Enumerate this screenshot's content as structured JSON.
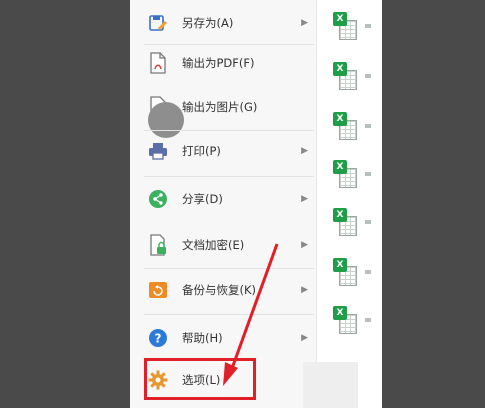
{
  "menu": {
    "items": [
      {
        "label": "另存为(A)",
        "icon": "save-as-icon",
        "has_submenu": true
      },
      {
        "label": "输出为PDF(F)",
        "icon": "pdf-export-icon",
        "has_submenu": false
      },
      {
        "label": "输出为图片(G)",
        "icon": "image-export-icon",
        "has_submenu": false
      },
      {
        "label": "打印(P)",
        "icon": "printer-icon",
        "has_submenu": true
      },
      {
        "label": "分享(D)",
        "icon": "share-icon",
        "has_submenu": true
      },
      {
        "label": "文档加密(E)",
        "icon": "document-lock-icon",
        "has_submenu": true
      },
      {
        "label": "备份与恢复(K)",
        "icon": "backup-restore-icon",
        "has_submenu": true
      },
      {
        "label": "帮助(H)",
        "icon": "help-icon",
        "has_submenu": true
      },
      {
        "label": "选项(L)",
        "icon": "gear-icon",
        "has_submenu": false
      }
    ],
    "arrow_glyph": "▶"
  },
  "files": {
    "badge": "X",
    "count": 7
  },
  "colors": {
    "excel_green": "#1e9e48",
    "highlight_red": "#e01f26",
    "share_green": "#3cb060",
    "help_blue": "#2b7bd6",
    "backup_orange": "#f08a24",
    "printer_blue": "#5a6ea8",
    "gear_orange": "#e8962e"
  }
}
